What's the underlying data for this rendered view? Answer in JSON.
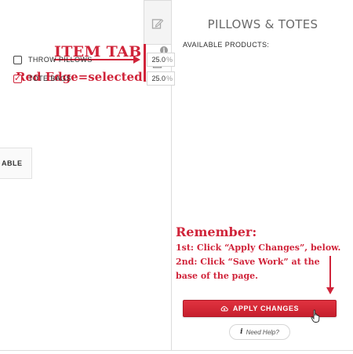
{
  "canvas": {
    "available_chip_label": "ABLE"
  },
  "annotations": {
    "item_tab": "ITEM TAB",
    "red_edge": "Red Edge=selected",
    "remember": "Remember:",
    "step1": "1st: Click “Apply Changes”, below.",
    "step2": "2nd: Click “Save Work” at the",
    "step3": "base of the page."
  },
  "tabs": [
    {
      "icon": "edit-icon",
      "selected": false
    },
    {
      "icon": "checklist-icon",
      "selected": true,
      "badge": "i"
    }
  ],
  "panel": {
    "title": "PILLOWS & TOTES",
    "section_label": "AVAILABLE PRODUCTS:",
    "products": [
      {
        "name": "THROW PILLOWS",
        "checked": false,
        "percent": "25.0",
        "unit": "%"
      },
      {
        "name": "TOTE BAGS",
        "checked": true,
        "percent": "25.0",
        "unit": "%"
      }
    ],
    "apply_label": "APPLY CHANGES",
    "help_icon": "i",
    "help_label": "Need Help?"
  },
  "colors": {
    "accent": "#d0243a",
    "border": "#dcdcdc",
    "muted_text": "#6a6a6a"
  }
}
